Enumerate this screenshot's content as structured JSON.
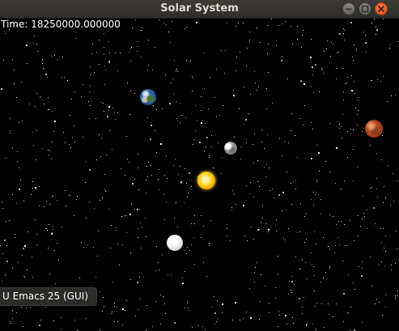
{
  "window": {
    "title": "Solar System"
  },
  "hud": {
    "time_text": "Time: 18250000.000000"
  },
  "tooltip": {
    "text": "U Emacs 25 (GUI)"
  },
  "colors": {
    "titlebar": "#3c3b37",
    "background": "#000000",
    "close_button": "#df4a16",
    "title_text": "#dfdbd2"
  },
  "icons": {
    "close": "close-icon",
    "minimize": "minimize-icon",
    "maximize": "maximize-icon"
  }
}
